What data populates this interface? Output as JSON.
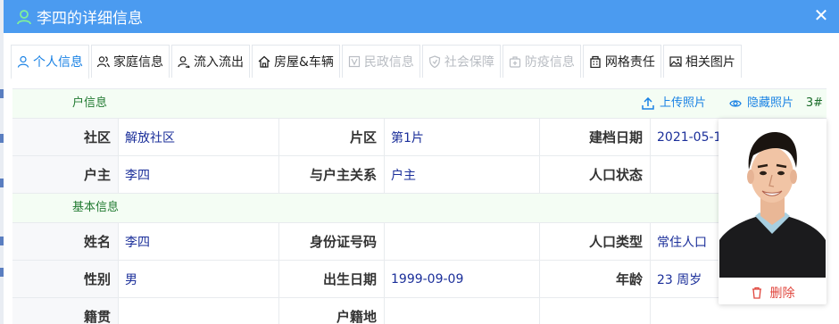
{
  "dialog": {
    "title": "李四的详细信息"
  },
  "tabs": [
    {
      "label": "个人信息",
      "state": "active",
      "icon": "user-icon"
    },
    {
      "label": "家庭信息",
      "state": "normal",
      "icon": "users-icon"
    },
    {
      "label": "流入流出",
      "state": "normal",
      "icon": "user-transfer-icon"
    },
    {
      "label": "房屋&车辆",
      "state": "normal",
      "icon": "house-icon"
    },
    {
      "label": "民政信息",
      "state": "disabled",
      "icon": "id-card-icon"
    },
    {
      "label": "社会保障",
      "state": "disabled",
      "icon": "shield-icon"
    },
    {
      "label": "防疫信息",
      "state": "disabled",
      "icon": "medical-kit-icon"
    },
    {
      "label": "网格责任",
      "state": "normal",
      "icon": "building-icon"
    },
    {
      "label": "相关图片",
      "state": "normal",
      "icon": "image-icon"
    }
  ],
  "household": {
    "section_label": "户信息",
    "upload_photo": "上传照片",
    "hide_photo": "隐藏照片",
    "building_no": "3#",
    "rows": [
      [
        {
          "label": "社区",
          "value": "解放社区"
        },
        {
          "label": "片区",
          "value": "第1片"
        },
        {
          "label": "建档日期",
          "value": "2021-05-1"
        }
      ],
      [
        {
          "label": "户主",
          "value": "李四"
        },
        {
          "label": "与户主关系",
          "value": "户主"
        },
        {
          "label": "人口状态",
          "value": ""
        }
      ]
    ]
  },
  "basic": {
    "section_label": "基本信息",
    "rows": [
      [
        {
          "label": "姓名",
          "value": "李四"
        },
        {
          "label": "身份证号码",
          "value": ""
        },
        {
          "label": "人口类型",
          "value": "常住人口"
        }
      ],
      [
        {
          "label": "性别",
          "value": "男"
        },
        {
          "label": "出生日期",
          "value": "1999-09-09"
        },
        {
          "label": "年龄",
          "value": "23 周岁"
        }
      ],
      [
        {
          "label": "籍贯",
          "value": ""
        },
        {
          "label": "户籍地",
          "value": ""
        },
        {
          "label": "",
          "value": ""
        }
      ]
    ]
  },
  "photo": {
    "delete_label": "删除"
  },
  "colors": {
    "title_bar": "#4b9bf0",
    "accent": "#1a82e4",
    "value_text": "#1b2f9a",
    "section_bg": "#f4fdf4",
    "section_text": "#217a31",
    "danger": "#e0463d"
  }
}
